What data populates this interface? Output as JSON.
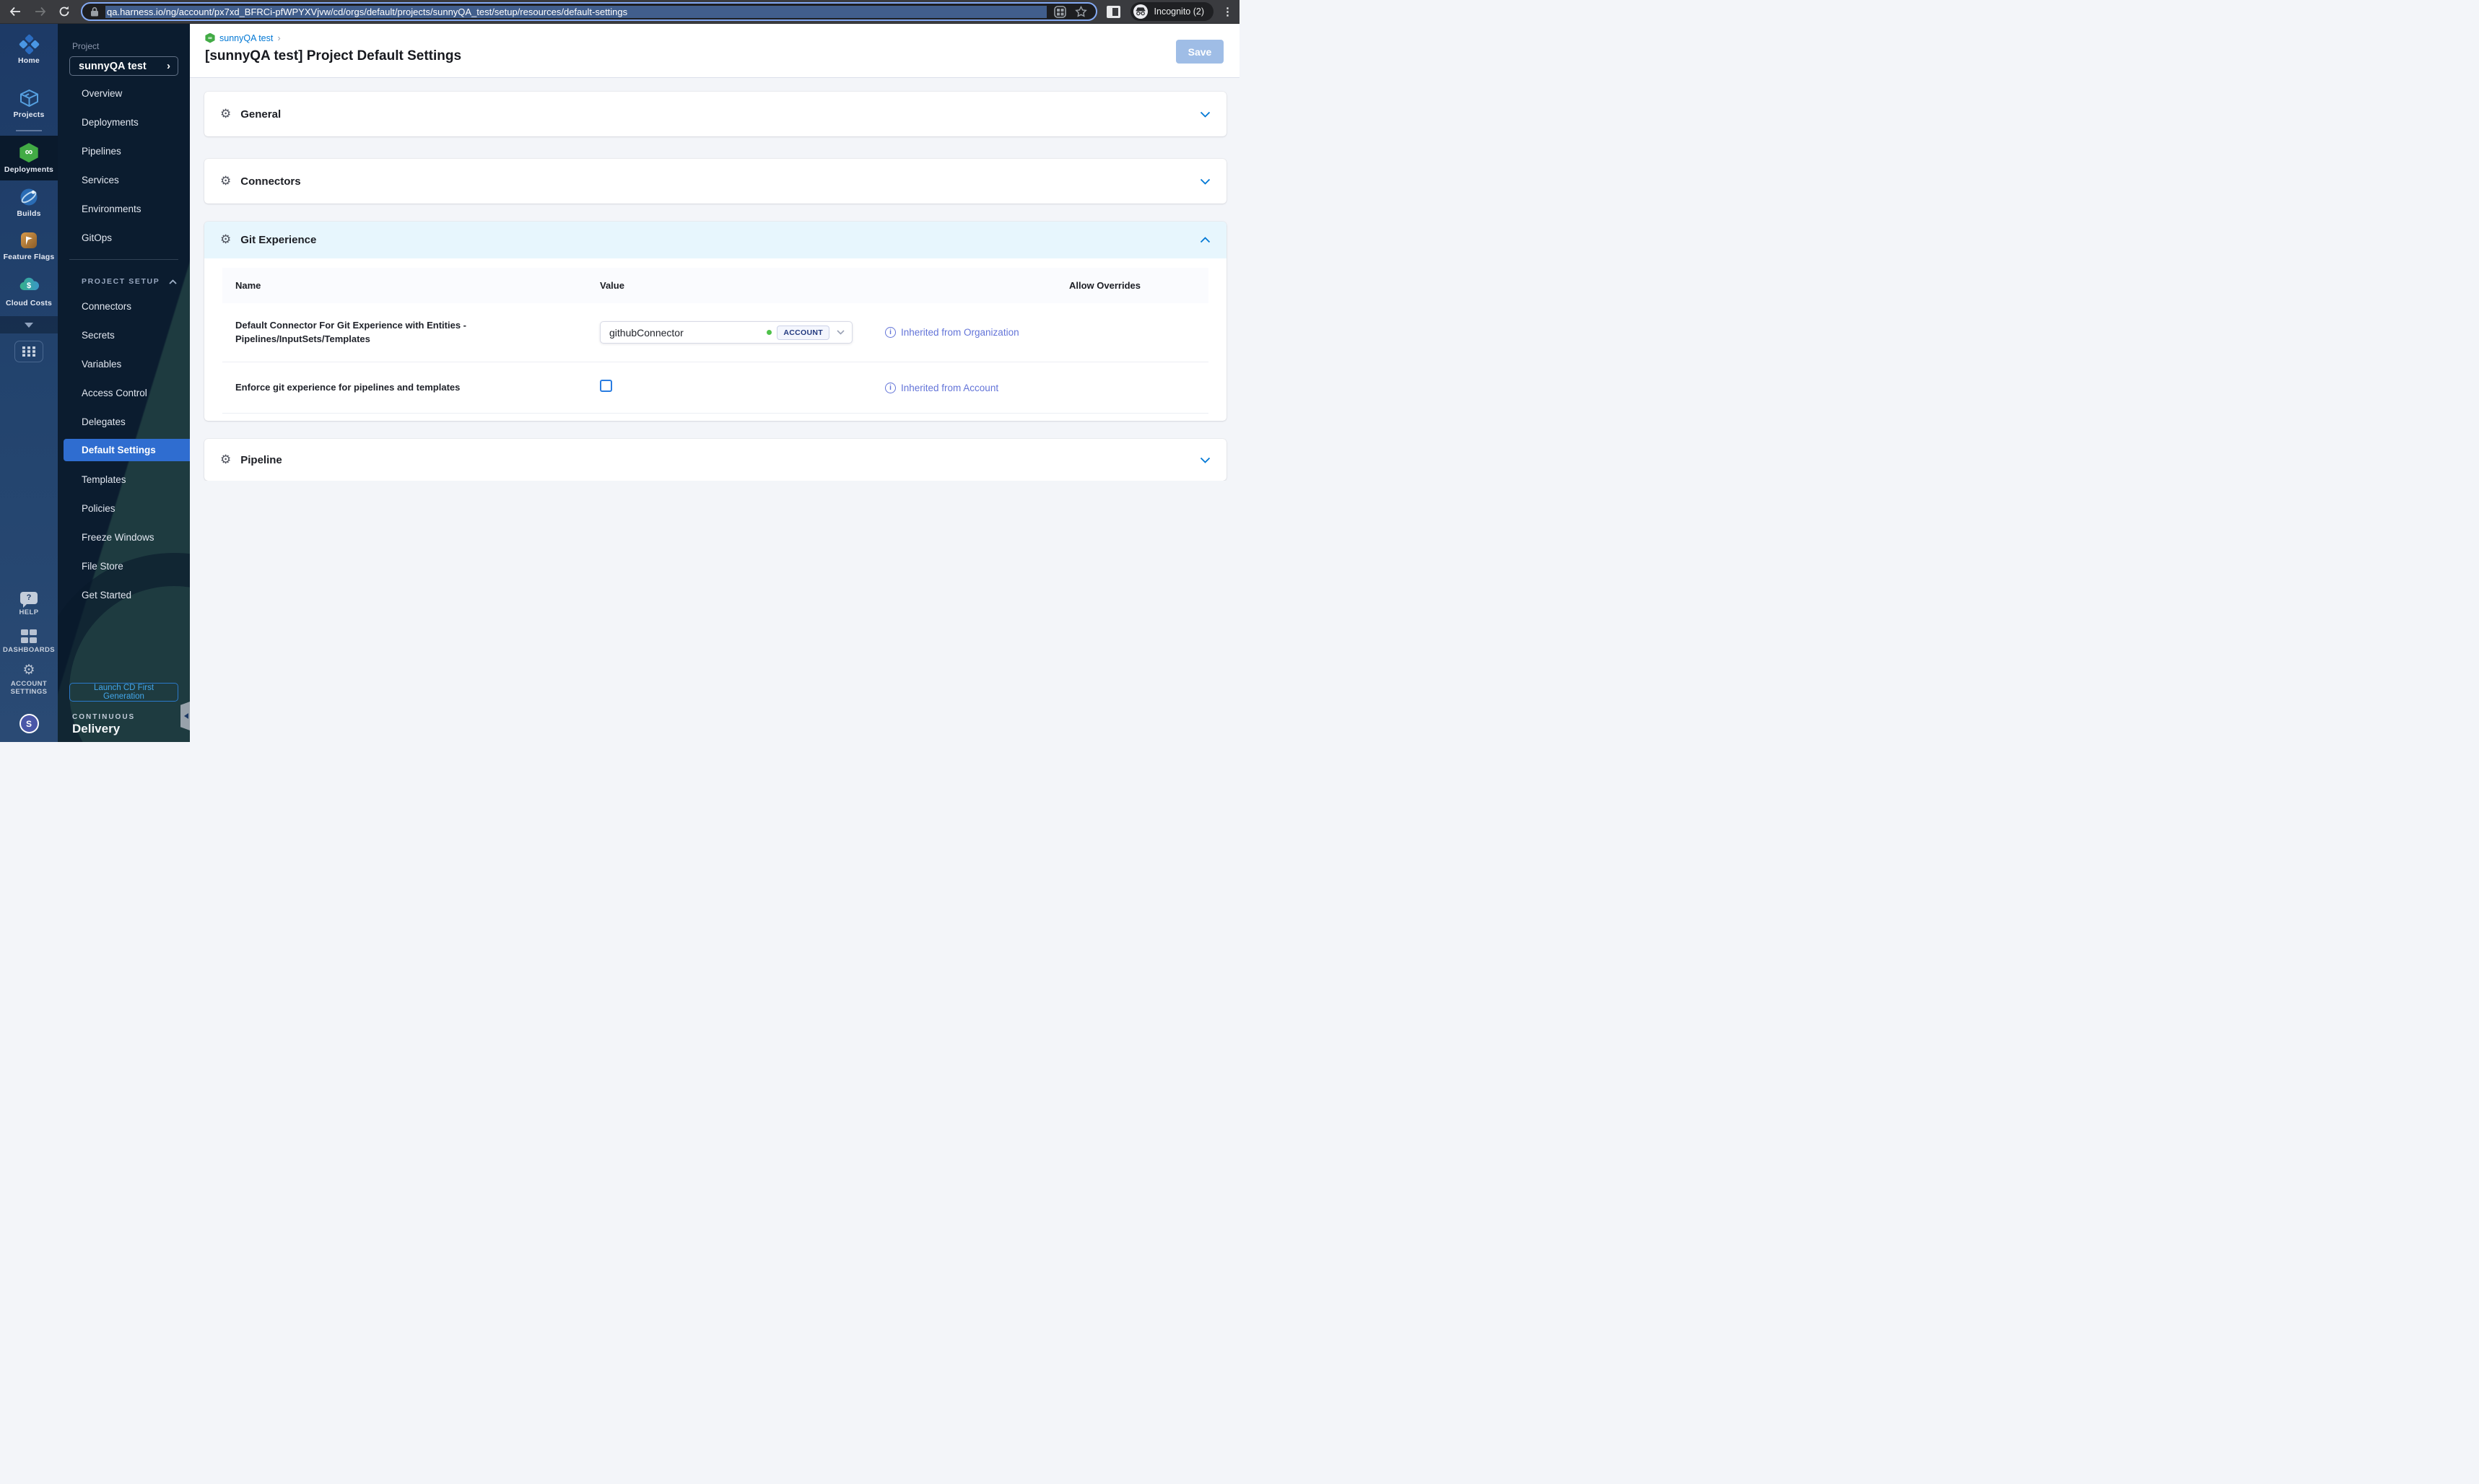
{
  "browser": {
    "url": "qa.harness.io/ng/account/px7xd_BFRCi-pfWPYXVjvw/cd/orgs/default/projects/sunnyQA_test/setup/resources/default-settings",
    "incognito_label": "Incognito (2)"
  },
  "icons": {
    "gear": "⚙",
    "infinity": "∞",
    "dollar": "$",
    "question": "?",
    "info": "i",
    "kebab": "⋮",
    "chevron_right": "›"
  },
  "rail": {
    "items": [
      {
        "label": "Home"
      },
      {
        "label": "Projects"
      },
      {
        "label": "Deployments",
        "active": true
      },
      {
        "label": "Builds"
      },
      {
        "label": "Feature Flags"
      },
      {
        "label": "Cloud Costs"
      }
    ],
    "bottom_items": [
      {
        "label": "HELP"
      },
      {
        "label": "DASHBOARDS"
      },
      {
        "label": "ACCOUNT SETTINGS"
      }
    ],
    "avatar_initial": "S"
  },
  "sidebar": {
    "project_label": "Project",
    "project_name": "sunnyQA test",
    "nav_items": [
      "Overview",
      "Deployments",
      "Pipelines",
      "Services",
      "Environments",
      "GitOps"
    ],
    "section_label": "PROJECT SETUP",
    "setup_items": [
      "Connectors",
      "Secrets",
      "Variables",
      "Access Control",
      "Delegates",
      "Default Settings",
      "Templates",
      "Policies",
      "Freeze Windows",
      "File Store",
      "Get Started"
    ],
    "active_item": "Default Settings",
    "launch_button": "Launch CD First Generation",
    "module_eyebrow": "CONTINUOUS",
    "module_name": "Delivery"
  },
  "header": {
    "breadcrumb": "sunnyQA test",
    "title": "[sunnyQA test] Project Default Settings",
    "save_label": "Save"
  },
  "sections": {
    "general": "General",
    "connectors": "Connectors",
    "git": "Git Experience",
    "pipeline": "Pipeline"
  },
  "git_table": {
    "columns": [
      "Name",
      "Value",
      "Allow Overrides"
    ],
    "rows": [
      {
        "name": "Default Connector For Git Experience with Entities - Pipelines/InputSets/Templates",
        "value": "githubConnector",
        "scope": "ACCOUNT",
        "status": "Inherited from Organization"
      },
      {
        "name": "Enforce git experience for pipelines and templates",
        "checkbox_checked": false,
        "status": "Inherited from Account"
      }
    ]
  },
  "colors": {
    "primary": "#0278d5",
    "link": "#6374d8",
    "nav_active": "#2f6dd0",
    "save_disabled": "#9fbde6",
    "deploy_green": "#42ab45"
  }
}
